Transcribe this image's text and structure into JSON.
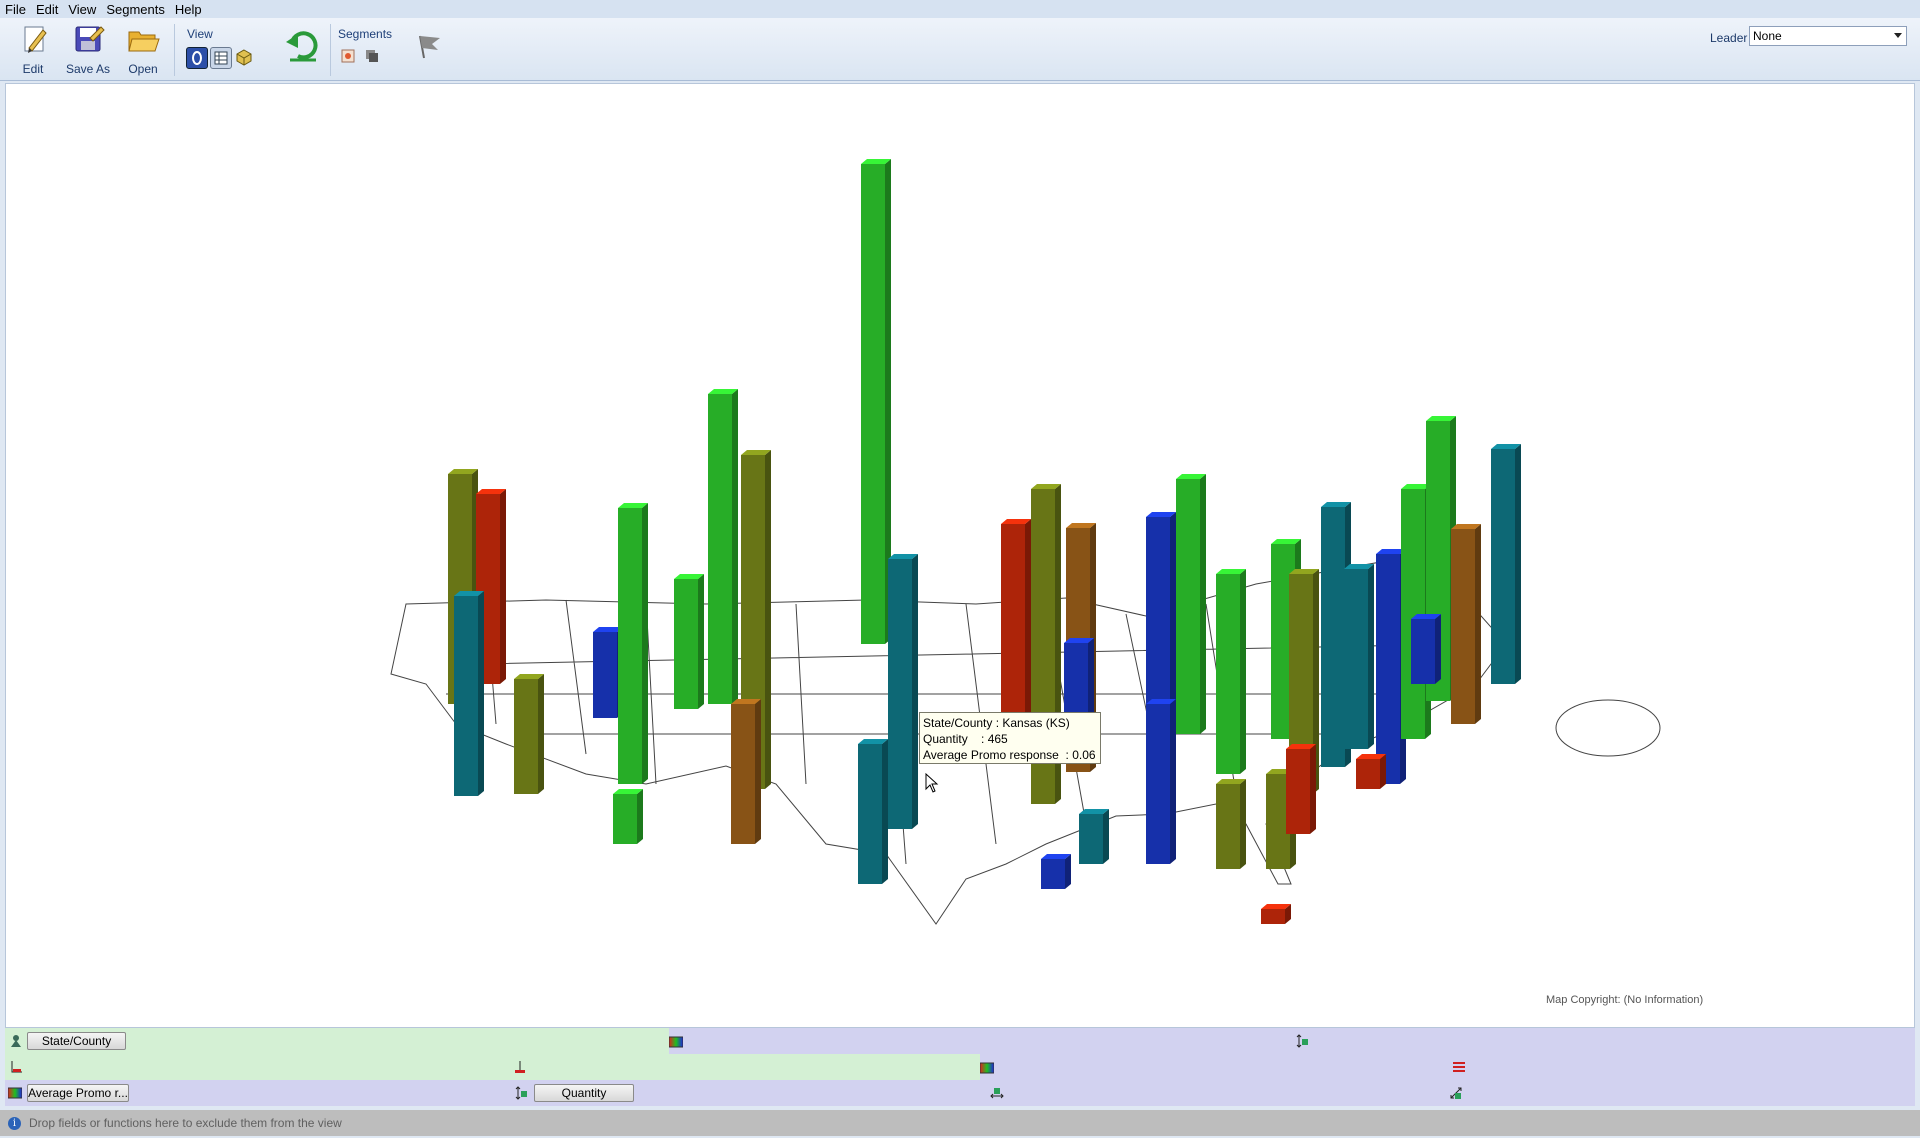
{
  "menu": [
    "File",
    "Edit",
    "View",
    "Segments",
    "Help"
  ],
  "toolbar": {
    "edit_label": "Edit",
    "save_as_label": "Save As",
    "open_label": "Open",
    "view_group_label": "View",
    "segments_group_label": "Segments",
    "leader_label": "Leader",
    "leader_value": "None"
  },
  "colors": {
    "bar_green": "#2ecc2e",
    "bar_olive": "#7a8a1a",
    "bar_brown": "#a0621a",
    "bar_red": "#cc2a0a",
    "bar_blue": "#1a38c8",
    "bar_teal": "#0f7a8a"
  },
  "map": {
    "copyright": "Map Copyright: (No Information)"
  },
  "tooltip": {
    "line1": "State/County : Kansas (KS)",
    "line2": "Quantity    : 465",
    "line3": "Average Promo response  : 0.06"
  },
  "shelves": {
    "geo_field": "State/County",
    "color_field": "Average Promo r...",
    "height_field": "Quantity"
  },
  "status": {
    "hint": "Drop fields or functions here to exclude them from the view"
  }
}
